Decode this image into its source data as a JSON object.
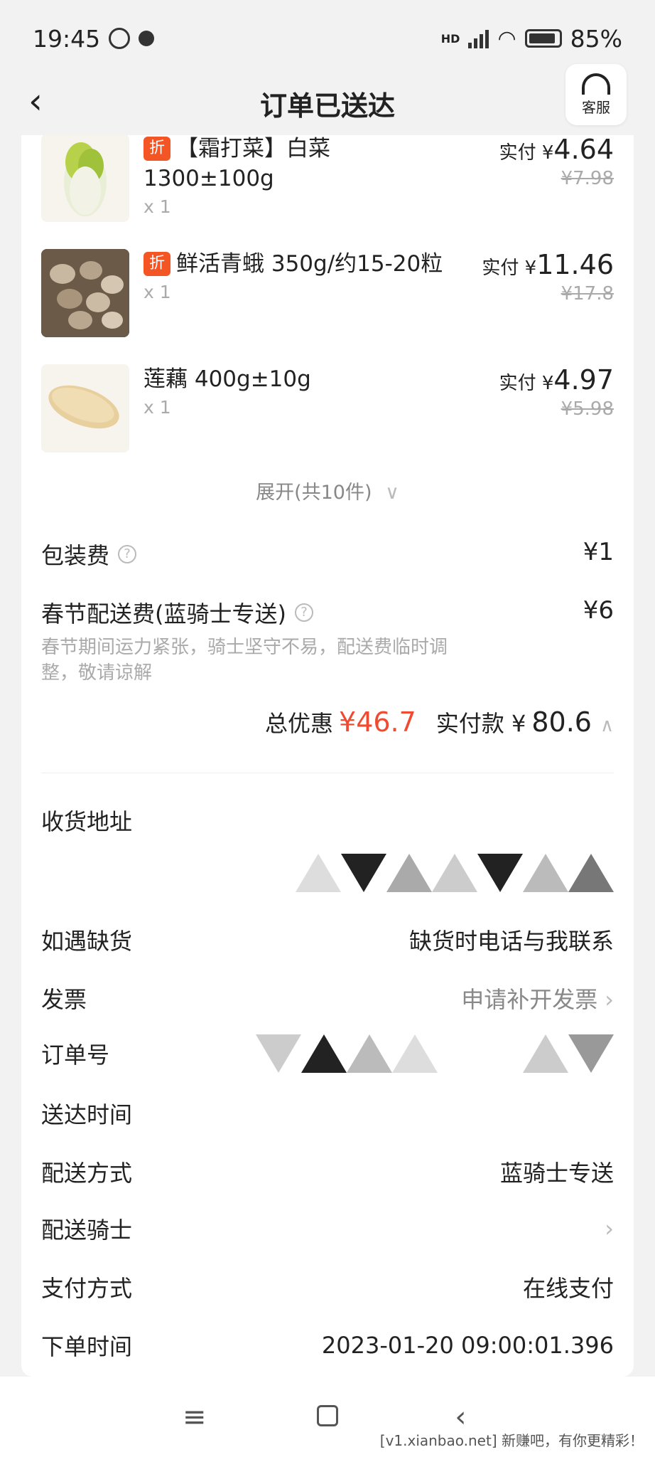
{
  "status": {
    "time": "19:45",
    "battery": "85%",
    "hd": "HD"
  },
  "header": {
    "title": "订单已送达",
    "service_label": "客服"
  },
  "items": [
    {
      "tag": "折",
      "name": "【霜打菜】白菜 1300±100g",
      "qty": "x 1",
      "paid_label": "实付 ¥",
      "paid": "4.64",
      "original": "¥7.98"
    },
    {
      "tag": "折",
      "name": "鲜活青蛾 350g/约15-20粒",
      "qty": "x 1",
      "paid_label": "实付 ¥",
      "paid": "11.46",
      "original": "¥17.8"
    },
    {
      "tag": "",
      "name": "莲藕 400g±10g",
      "qty": "x 1",
      "paid_label": "实付 ¥",
      "paid": "4.97",
      "original": "¥5.98"
    }
  ],
  "expand_label": "展开(共10件)",
  "fees": {
    "packaging_label": "包装费",
    "packaging_value": "¥1",
    "delivery_label": "春节配送费(蓝骑士专送)",
    "delivery_value": "¥6",
    "delivery_note": "春节期间运力紧张，骑士坚守不易，配送费临时调整，敬请谅解"
  },
  "totals": {
    "discount_label": "总优惠",
    "discount_value": "¥46.7",
    "pay_label": "实付款 ¥",
    "pay_value": "80.6"
  },
  "info": {
    "address_label": "收货地址",
    "stockout_label": "如遇缺货",
    "stockout_value": "缺货时电话与我联系",
    "invoice_label": "发票",
    "invoice_value": "申请补开发票",
    "order_no_label": "订单号",
    "delivered_time_label": "送达时间",
    "delivery_method_label": "配送方式",
    "delivery_method_value": "蓝骑士专送",
    "rider_label": "配送骑士",
    "payment_label": "支付方式",
    "payment_value": "在线支付",
    "order_time_label": "下单时间",
    "order_time_value": "2023-01-20 09:00:01.396"
  },
  "watermark": "[v1.xianbao.net] 新赚吧，有你更精彩！",
  "colors": {
    "accent": "#f04a30",
    "tag": "#f35525"
  }
}
